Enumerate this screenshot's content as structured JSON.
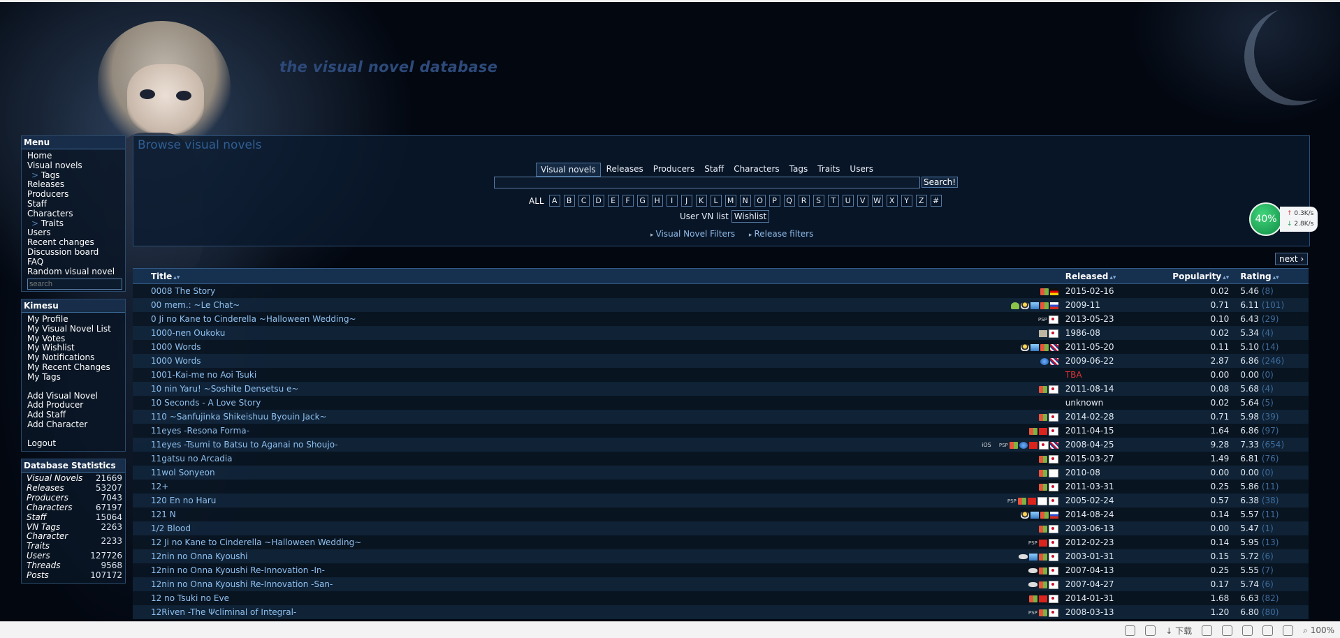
{
  "site": {
    "title": "the visual novel database"
  },
  "menu": {
    "heading": "Menu",
    "items": [
      {
        "label": "Home",
        "sub": false
      },
      {
        "label": "Visual novels",
        "sub": false
      },
      {
        "label": "Tags",
        "sub": true
      },
      {
        "label": "Releases",
        "sub": false
      },
      {
        "label": "Producers",
        "sub": false
      },
      {
        "label": "Staff",
        "sub": false
      },
      {
        "label": "Characters",
        "sub": false
      },
      {
        "label": "Traits",
        "sub": true
      },
      {
        "label": "Users",
        "sub": false
      },
      {
        "label": "Recent changes",
        "sub": false
      },
      {
        "label": "Discussion board",
        "sub": false
      },
      {
        "label": "FAQ",
        "sub": false
      },
      {
        "label": "Random visual novel",
        "sub": false
      }
    ],
    "search_placeholder": "search"
  },
  "user_menu": {
    "heading": "Kimesu",
    "items": [
      "My Profile",
      "My Visual Novel List",
      "My Votes",
      "My Wishlist",
      "My Notifications",
      "My Recent Changes",
      "My Tags"
    ],
    "add_items": [
      "Add Visual Novel",
      "Add Producer",
      "Add Staff",
      "Add Character"
    ],
    "logout": "Logout"
  },
  "stats": {
    "heading": "Database Statistics",
    "rows": [
      {
        "k": "Visual Novels",
        "v": "21669"
      },
      {
        "k": "Releases",
        "v": "53207"
      },
      {
        "k": "Producers",
        "v": "7043"
      },
      {
        "k": "Characters",
        "v": "67197"
      },
      {
        "k": "Staff",
        "v": "15064"
      },
      {
        "k": "VN Tags",
        "v": "2263"
      },
      {
        "k": "Character Traits",
        "v": "2233"
      },
      {
        "k": "Users",
        "v": "127726"
      },
      {
        "k": "Threads",
        "v": "9568"
      },
      {
        "k": "Posts",
        "v": "107172"
      }
    ]
  },
  "browse": {
    "heading": "Browse visual novels",
    "tabs": [
      "Visual novels",
      "Releases",
      "Producers",
      "Staff",
      "Characters",
      "Tags",
      "Traits",
      "Users"
    ],
    "active_tab": "Visual novels",
    "search_button": "Search!",
    "all_label": "ALL",
    "letters": [
      "A",
      "B",
      "C",
      "D",
      "E",
      "F",
      "G",
      "H",
      "I",
      "J",
      "K",
      "L",
      "M",
      "N",
      "O",
      "P",
      "Q",
      "R",
      "S",
      "T",
      "U",
      "V",
      "W",
      "X",
      "Y",
      "Z",
      "#"
    ],
    "user_vn_list": "User VN list",
    "wishlist": "Wishlist",
    "vn_filters": "Visual Novel Filters",
    "release_filters": "Release filters"
  },
  "next_label": "next ›",
  "table": {
    "headers": {
      "title": "Title",
      "released": "Released",
      "popularity": "Popularity",
      "rating": "Rating"
    },
    "rows": [
      {
        "title": "0008 The Story",
        "icons": [
          "i-win",
          "i-flag-de"
        ],
        "released": "2015-02-16",
        "popularity": "0.02",
        "rating": "5.46",
        "votes": "(8)"
      },
      {
        "title": "00 mem.: ~Le Chat~",
        "icons": [
          "i-and",
          "i-lin",
          "i-mac",
          "i-win",
          "i-flag-ru"
        ],
        "released": "2009-11",
        "popularity": "0.71",
        "rating": "6.11",
        "votes": "(101)"
      },
      {
        "title": "0 Ji no Kane to Cinderella ~Halloween Wedding~",
        "icons": [
          "i-psp",
          "i-flag-jp"
        ],
        "released": "2013-05-23",
        "popularity": "0.10",
        "rating": "6.43",
        "votes": "(29)"
      },
      {
        "title": "1000-nen Oukoku",
        "icons": [
          "i-pc98",
          "i-flag-jp"
        ],
        "released": "1986-08",
        "popularity": "0.02",
        "rating": "5.34",
        "votes": "(4)"
      },
      {
        "title": "1000 Words",
        "icons": [
          "i-lin",
          "i-mac",
          "i-win",
          "i-flag-en"
        ],
        "released": "2011-05-20",
        "popularity": "0.11",
        "rating": "5.10",
        "votes": "(14)"
      },
      {
        "title": "1000 Words",
        "icons": [
          "i-web",
          "i-flag-en"
        ],
        "released": "2009-06-22",
        "popularity": "2.87",
        "rating": "6.86",
        "votes": "(246)"
      },
      {
        "title": "1001-Kai-me no Aoi Tsuki",
        "icons": [],
        "released": "TBA",
        "popularity": "0.00",
        "rating": "0.00",
        "votes": "(0)",
        "tba": true
      },
      {
        "title": "10 nin Yaru! ~Soshite Densetsu e~",
        "icons": [
          "i-win",
          "i-flag-jp"
        ],
        "released": "2011-08-14",
        "popularity": "0.08",
        "rating": "5.68",
        "votes": "(4)"
      },
      {
        "title": "10 Seconds - A Love Story",
        "icons": [],
        "released": "unknown",
        "popularity": "0.02",
        "rating": "5.64",
        "votes": "(5)"
      },
      {
        "title": "110 ~Sanfujinka Shikeishuu Byouin Jack~",
        "icons": [
          "i-win",
          "i-flag-jp"
        ],
        "released": "2014-02-28",
        "popularity": "0.71",
        "rating": "5.98",
        "votes": "(39)"
      },
      {
        "title": "11eyes -Resona Forma-",
        "icons": [
          "i-win",
          "i-flag-cn",
          "i-flag-jp"
        ],
        "released": "2011-04-15",
        "popularity": "1.64",
        "rating": "6.86",
        "votes": "(97)"
      },
      {
        "title": "11eyes -Tsumi to Batsu to Aganai no Shoujo-",
        "icons": [
          "i-ios",
          "i-psp",
          "i-win",
          "i-web",
          "i-flag-cn",
          "i-flag-jp",
          "i-flag-en"
        ],
        "released": "2008-04-25",
        "popularity": "9.28",
        "rating": "7.33",
        "votes": "(654)"
      },
      {
        "title": "11gatsu no Arcadia",
        "icons": [
          "i-win",
          "i-flag-jp"
        ],
        "released": "2015-03-27",
        "popularity": "1.49",
        "rating": "6.81",
        "votes": "(76)"
      },
      {
        "title": "11wol Sonyeon",
        "icons": [
          "i-win",
          "i-flag-kr"
        ],
        "released": "2010-08",
        "popularity": "0.00",
        "rating": "0.00",
        "votes": "(0)"
      },
      {
        "title": "12+",
        "icons": [
          "i-win",
          "i-flag-jp"
        ],
        "released": "2011-03-31",
        "popularity": "0.25",
        "rating": "5.86",
        "votes": "(11)"
      },
      {
        "title": "120 En no Haru",
        "icons": [
          "i-psp",
          "i-win",
          "i-flag-cn",
          "i-flag-kr",
          "i-flag-jp"
        ],
        "released": "2005-02-24",
        "popularity": "0.57",
        "rating": "6.38",
        "votes": "(38)"
      },
      {
        "title": "121 N",
        "icons": [
          "i-lin",
          "i-mac",
          "i-win",
          "i-flag-ru"
        ],
        "released": "2014-08-24",
        "popularity": "0.14",
        "rating": "5.57",
        "votes": "(11)"
      },
      {
        "title": "1/2 Blood",
        "icons": [
          "i-win",
          "i-flag-jp"
        ],
        "released": "2003-06-13",
        "popularity": "0.00",
        "rating": "5.47",
        "votes": "(1)"
      },
      {
        "title": "12 Ji no Kane to Cinderella ~Halloween Wedding~",
        "icons": [
          "i-psp",
          "i-flag-cn",
          "i-flag-jp"
        ],
        "released": "2012-02-23",
        "popularity": "0.14",
        "rating": "5.95",
        "votes": "(13)"
      },
      {
        "title": "12nin no Onna Kyoushi",
        "icons": [
          "i-dvd",
          "i-mac",
          "i-win",
          "i-flag-jp"
        ],
        "released": "2003-01-31",
        "popularity": "0.15",
        "rating": "5.72",
        "votes": "(6)"
      },
      {
        "title": "12nin no Onna Kyoushi Re-Innovation -In-",
        "icons": [
          "i-dvd",
          "i-win",
          "i-flag-jp"
        ],
        "released": "2007-04-13",
        "popularity": "0.25",
        "rating": "5.55",
        "votes": "(7)"
      },
      {
        "title": "12nin no Onna Kyoushi Re-Innovation -San-",
        "icons": [
          "i-dvd",
          "i-win",
          "i-flag-jp"
        ],
        "released": "2007-04-27",
        "popularity": "0.17",
        "rating": "5.74",
        "votes": "(6)"
      },
      {
        "title": "12 no Tsuki no Eve",
        "icons": [
          "i-win",
          "i-flag-cn",
          "i-flag-jp"
        ],
        "released": "2014-01-31",
        "popularity": "1.68",
        "rating": "6.63",
        "votes": "(82)"
      },
      {
        "title": "12Riven -The Ψcliminal of Integral-",
        "icons": [
          "i-psp",
          "i-win",
          "i-flag-jp"
        ],
        "released": "2008-03-13",
        "popularity": "1.20",
        "rating": "6.80",
        "votes": "(80)"
      }
    ]
  },
  "speed": {
    "percent": "40%",
    "up": "0.3K/s",
    "down": "2.8K/s"
  },
  "status": {
    "download": "下载",
    "zoom": "100%"
  }
}
